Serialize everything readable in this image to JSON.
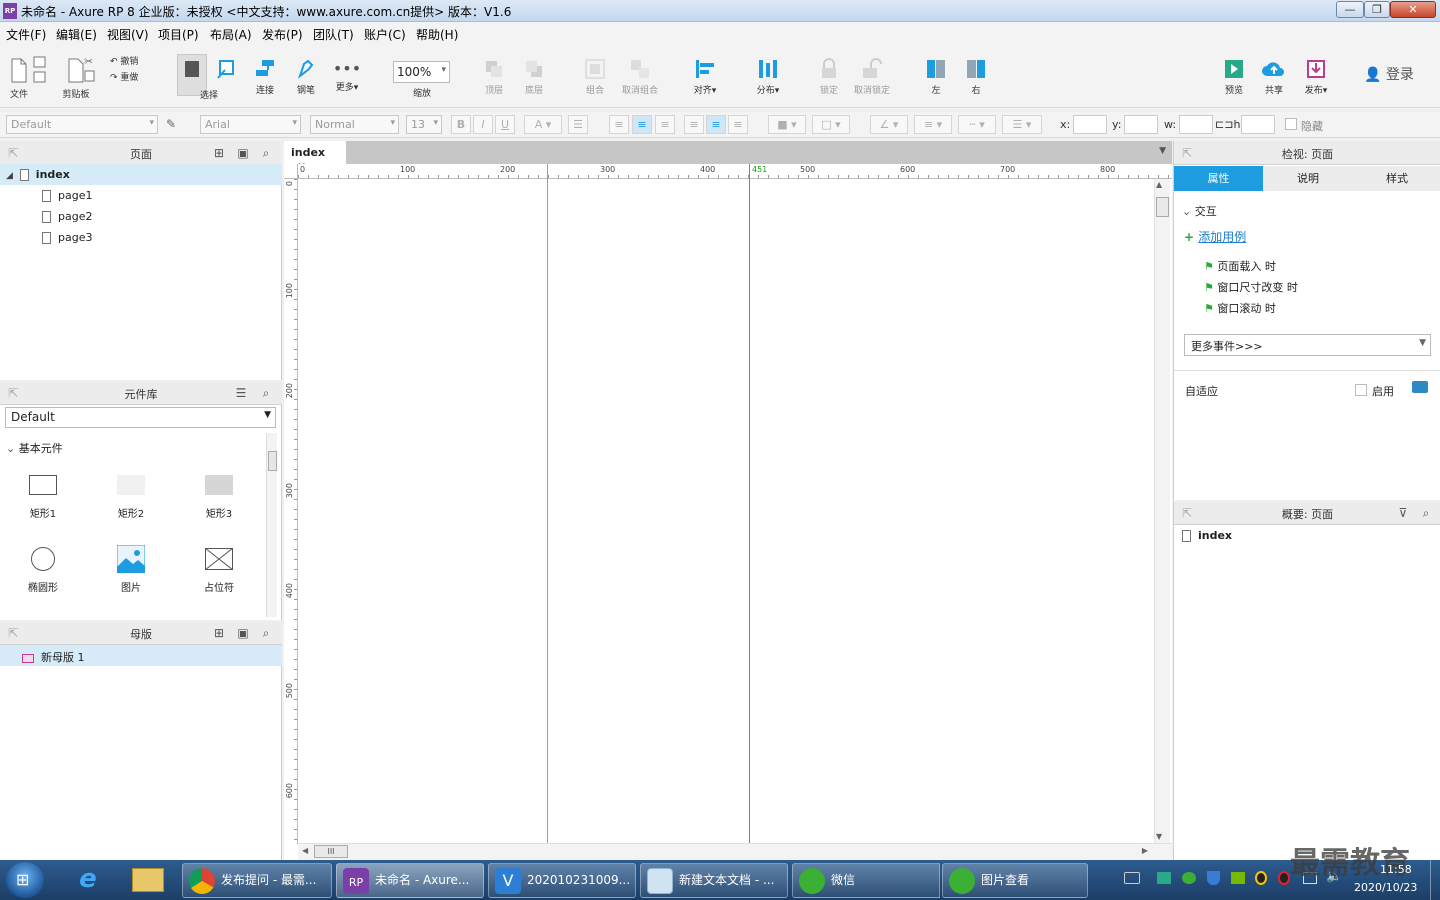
{
  "window": {
    "title": "未命名 - Axure RP 8 企业版：未授权      <中文支持：www.axure.com.cn提供> 版本：V1.6",
    "app_icon_text": "RP",
    "min": "—",
    "max": "❐",
    "close": "✕"
  },
  "menu": [
    "文件(F)",
    "编辑(E)",
    "视图(V)",
    "项目(P)",
    "布局(A)",
    "发布(P)",
    "团队(T)",
    "账户(C)",
    "帮助(H)"
  ],
  "toolbar": {
    "file": "文件",
    "clipboard": "剪贴板",
    "undo": "撤销",
    "redo": "重做",
    "select": "选择",
    "connect": "连接",
    "pen": "钢笔",
    "more": "更多▾",
    "zoom_value": "100%",
    "zoom_label": "缩放",
    "top": "顶层",
    "bottom": "底层",
    "group": "组合",
    "ungroup": "取消组合",
    "align": "对齐▾",
    "distribute": "分布▾",
    "lock": "锁定",
    "unlock": "取消锁定",
    "left": "左",
    "right": "右",
    "preview": "预览",
    "share": "共享",
    "publish": "发布▾",
    "login": "登录"
  },
  "format": {
    "style": "Default",
    "font": "Arial",
    "weight": "Normal",
    "size": "13",
    "bold": "B",
    "italic": "I",
    "underline": "U",
    "x_label": "x:",
    "y_label": "y:",
    "w_label": "w:",
    "h_label": "h:",
    "hide_label": "隐藏"
  },
  "pages_panel": {
    "title": "页面",
    "root": "index",
    "children": [
      "page1",
      "page2",
      "page3"
    ]
  },
  "library_panel": {
    "title": "元件库",
    "selected": "Default",
    "group": "基本元件",
    "items": [
      "矩形1",
      "矩形2",
      "矩形3",
      "椭圆形",
      "图片",
      "占位符"
    ]
  },
  "masters_panel": {
    "title": "母版",
    "items": [
      "新母版 1"
    ]
  },
  "canvas": {
    "tab": "index",
    "tab_close": "×",
    "h_ruler": [
      "0",
      "100",
      "200",
      "300",
      "400",
      "451",
      "500",
      "600",
      "700",
      "800"
    ],
    "v_ruler": [
      "0",
      "100",
      "200",
      "300",
      "400",
      "500",
      "600"
    ],
    "hscroll_grip": "III"
  },
  "inspector": {
    "title": "检视: 页面",
    "tabs": [
      "属性",
      "说明",
      "样式"
    ],
    "interaction": "交互",
    "add_case": "添加用例",
    "events": [
      "页面载入 时",
      "窗口尺寸改变 时",
      "窗口滚动 时"
    ],
    "more_events": "更多事件>>>",
    "adaptive": "自适应",
    "enable": "启用"
  },
  "outline": {
    "title": "概要: 页面",
    "item": "index"
  },
  "taskbar": {
    "items": [
      "发布提问 - 最需...",
      "未命名 - Axure...",
      "202010231009...",
      "新建文本文档 - ...",
      "微信",
      "图片查看"
    ],
    "time": "11:58",
    "date": "2020/10/23",
    "watermark": "最需教育"
  },
  "colors": {
    "accent_blue": "#1e9ce0",
    "selected_row": "#d5ecf8",
    "guide_cyan": "#33cccc",
    "guide_green": "#33bb33"
  }
}
